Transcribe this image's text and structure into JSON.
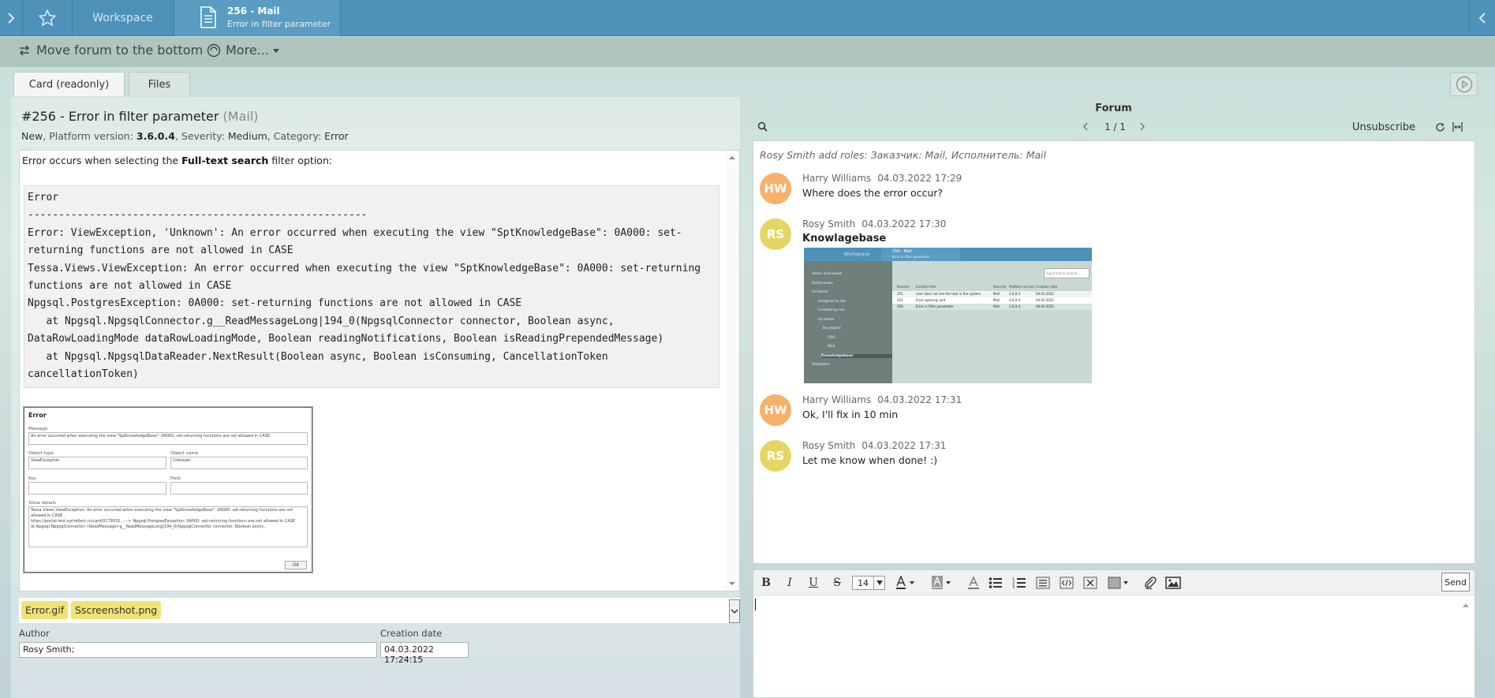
{
  "topbar": {
    "workspace_label": "Workspace",
    "mail_tab_title": "256 - Mail",
    "mail_tab_subtitle": "Error in filter parameter"
  },
  "toolbar": {
    "move_forum_label": "Move forum to the bottom",
    "more_label": "More..."
  },
  "tabs": [
    {
      "label": "Card (readonly)",
      "active": true
    },
    {
      "label": "Files",
      "active": false
    }
  ],
  "card": {
    "title": "#256 - Error in filter parameter",
    "title_suffix": "(Mail)",
    "meta": {
      "status": "New",
      "platform_label": "Platform version:",
      "platform_value": "3.6.0.4",
      "severity_label": "Severity:",
      "severity_value": "Medium",
      "category_label": "Category:",
      "category_value": "Error"
    },
    "description_prefix": "Error occurs when selecting the",
    "description_bold": "Full-text search",
    "description_suffix": "filter option:",
    "code_block": "Error\n-------------------------------------------------------\nError: ViewException, 'Unknown': An error occurred when executing the view \"SptKnowledgeBase\": 0A000: set-returning functions are not allowed in CASE\nTessa.Views.ViewException: An error occurred when executing the view \"SptKnowledgeBase\": 0A000: set-returning functions are not allowed in CASE\nNpgsql.PostgresException: 0A000: set-returning functions are not allowed in CASE\n   at Npgsql.NpgsqlConnector.g__ReadMessageLong|194_0(NpgsqlConnector connector, Boolean async, DataRowLoadingMode dataRowLoadingMode, Boolean readingNotifications, Boolean isReadingPrependedMessage)\n   at Npgsql.NpgsqlDataReader.NextResult(Boolean async, Boolean isConsuming, CancellationToken cancellationToken)",
    "error_dialog": {
      "title": "Error",
      "message_label": "Message",
      "message_text": "An error occurred when executing the view \"SptKnowledgeBase\": 0A000: set-returning functions are not allowed in CASE",
      "object_type_label": "Object type",
      "object_type_value": "ViewException",
      "object_name_label": "Object name",
      "object_name_value": "Unknown",
      "key_label": "Key",
      "field_label": "Field",
      "details_label": "Show details",
      "details_text1": "Tessa.Views.ViewException: An error occurred when executing the view \"SptKnowledgeBase\": 0A000: set-returning functions are not allowed in CASE",
      "details_text2": "https://portal-test.syntellect.ru/card/0179532...---> Npgsql.PostgresException: 0A000: set-returning functions are not allowed in CASE",
      "details_text3": "at Npgsql.NpgsqlConnector.<ReadMessage>g__ReadMessageLong|194_0(NpgsqlConnector connector, Boolean async,",
      "ok_label": "OK"
    },
    "attachments": [
      "Error.gif",
      "Sscreenshot.png"
    ],
    "author_label": "Author",
    "author_value": "Rosy Smith;",
    "creation_label": "Creation date",
    "creation_value": "04.03.2022 17:24:15"
  },
  "forum": {
    "title": "Forum",
    "page_indicator": "1 / 1",
    "unsubscribe_label": "Unsubscribe",
    "system_message": "Rosy Smith add roles: Заказчик: Mail, Исполнитель: Mail",
    "messages": [
      {
        "initials": "HW",
        "author": "Harry Williams",
        "time": "04.03.2022 17:29",
        "text": "Where does the error occur?"
      },
      {
        "initials": "RS",
        "author": "Rosy Smith",
        "time": "04.03.2022 17:30",
        "text": "Knowlagebase"
      },
      {
        "initials": "HW",
        "author": "Harry Williams",
        "time": "04.03.2022 17:31",
        "text": "Ok, I'll fix in 10 min"
      },
      {
        "initials": "RS",
        "author": "Rosy Smith",
        "time": "04.03.2022 17:31",
        "text": "Let me know when done! :)"
      }
    ],
    "kb_screenshot": {
      "ws_label": "Workspace",
      "tab_title": "256 - Mail",
      "tab_sub": "Error in filter parameter",
      "search_placeholder": "Input text to search...",
      "tree": [
        "Views and Issues",
        "Dictionaries",
        "Incidents",
        "Assigned to me",
        "Created by me",
        "Incidents",
        "By project",
        "CRG",
        "Mail",
        "Knowledgebase",
        "Templates"
      ],
      "columns": [
        "Number",
        "Incident title",
        "Severity",
        "Platform version",
        "Creation date"
      ],
      "rows": [
        [
          "255",
          "User does not see the task in the system",
          "Mail",
          "3.6.0.4",
          "04.03.2022"
        ],
        [
          "253",
          "Error opening card",
          "Mail",
          "3.6.0.4",
          "04.03.2022"
        ],
        [
          "256",
          "Error in filter parameter",
          "Mail",
          "3.6.0.4",
          "04.03.2022"
        ]
      ]
    }
  },
  "editor": {
    "font_size": "14",
    "send_label": "Send"
  }
}
